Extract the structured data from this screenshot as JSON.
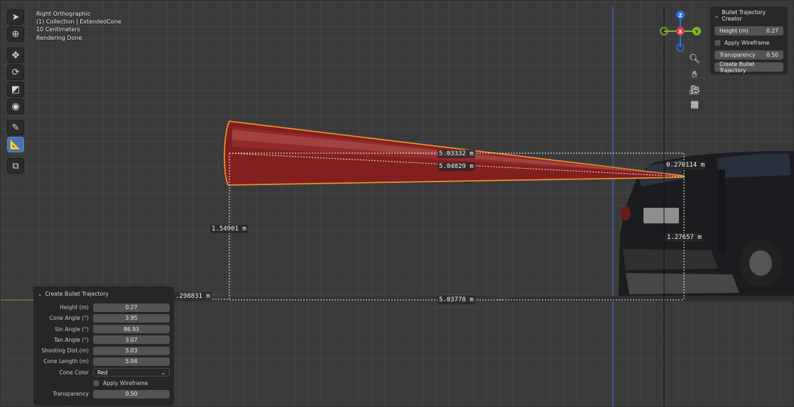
{
  "viewport_info": {
    "view_name": "Right Orthographic",
    "collection": "(1) Collection | ExtendedCone",
    "grid_scale": "10 Centimeters",
    "status": "Rendering Done"
  },
  "toolbar": {
    "tools": [
      {
        "name": "select-box",
        "icon": "cursor-icon",
        "active": false
      },
      {
        "name": "cursor",
        "icon": "crosshair-icon",
        "active": false
      },
      {
        "name": "move",
        "icon": "move-icon",
        "active": false
      },
      {
        "name": "rotate",
        "icon": "rotate-icon",
        "active": false
      },
      {
        "name": "scale",
        "icon": "scale-icon",
        "active": false
      },
      {
        "name": "transform",
        "icon": "transform-icon",
        "active": false
      },
      {
        "name": "annotate",
        "icon": "pencil-icon",
        "active": false
      },
      {
        "name": "measure",
        "icon": "ruler-icon",
        "active": true
      },
      {
        "name": "add-cube",
        "icon": "add-cube-icon",
        "active": false
      }
    ]
  },
  "gizmo": {
    "z_label": "Z",
    "x_label": "X",
    "y_label": "Y",
    "colors": {
      "z": "#2a6fe0",
      "x": "#e0394d",
      "y": "#82b82b"
    }
  },
  "sidebar_panel": {
    "title": "Bullet Trajectory Creator",
    "height_label": "Height (m)",
    "height_value": "0.27",
    "wireframe_label": "Apply Wireframe",
    "transparency_label": "Transparency",
    "transparency_value": "0.50",
    "create_button": "Create Bullet Trajectory"
  },
  "redo_panel": {
    "title": "Create Bullet Trajectory",
    "props": [
      {
        "label": "Height (m)",
        "value": "0.27"
      },
      {
        "label": "Cone Angle (°)",
        "value": "3.95"
      },
      {
        "label": "Sin Angle (°)",
        "value": "86.93"
      },
      {
        "label": "Tan Angle (°)",
        "value": "3.07"
      },
      {
        "label": "Shooting Dist.(m)",
        "value": "5.03"
      },
      {
        "label": "Cone Length (m)",
        "value": "5.04"
      }
    ],
    "cone_color_label": "Cone Color",
    "cone_color_value": "Red",
    "wireframe_label": "Apply Wireframe",
    "transparency_label": "Transparency",
    "transparency_value": "0.50"
  },
  "measurements": {
    "m1": "5.03332 m",
    "m2": "5.04029 m",
    "m3": "0.270114 m",
    "m4": "1.54901 m",
    "m5": "1.27657 m",
    "m6": "5.03778 m",
    "m7": ".298831 m"
  },
  "colors": {
    "cone": "#8a1d1d",
    "cone_outline": "#f39a2a",
    "active_tool": "#4772b3",
    "x_axis": "#3a7ad9",
    "y_axis": "#6e8c3a"
  }
}
